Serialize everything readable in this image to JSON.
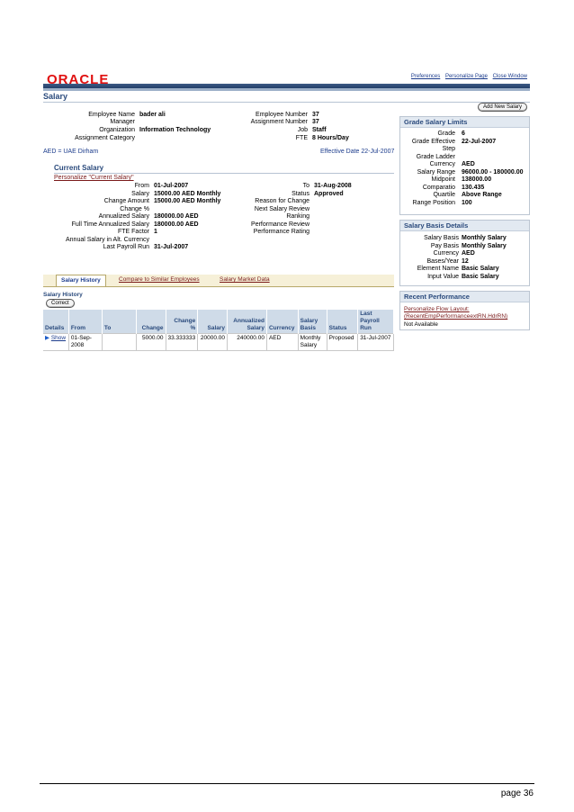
{
  "header": {
    "logo": "ORACLE",
    "links": [
      "Preferences",
      "Personalize Page",
      "Close Window"
    ],
    "page_title": "Salary",
    "add_button": "Add New Salary"
  },
  "employee": {
    "left": [
      {
        "label": "Employee Name",
        "value": "bader ali"
      },
      {
        "label": "Manager",
        "value": ""
      },
      {
        "label": "Organization",
        "value": "Information Technology"
      },
      {
        "label": "Assignment Category",
        "value": ""
      }
    ],
    "right": [
      {
        "label": "Employee Number",
        "value": "37"
      },
      {
        "label": "Assignment Number",
        "value": "37"
      },
      {
        "label": "Job",
        "value": "Staff"
      },
      {
        "label": "FTE",
        "value": "8 Hours/Day"
      }
    ]
  },
  "currency_note": "AED = UAE Dirham",
  "effective_date": "Effective Date 22-Jul-2007",
  "current_salary": {
    "title": "Current Salary",
    "personalize": "Personalize \"Current Salary\"",
    "left": [
      {
        "label": "From",
        "value": "01-Jul-2007"
      },
      {
        "label": "Salary",
        "value": "15000.00 AED Monthly"
      },
      {
        "label": "Change Amount",
        "value": "15000.00 AED Monthly"
      },
      {
        "label": "Change %",
        "value": ""
      },
      {
        "label": "Annualized Salary",
        "value": "180000.00 AED"
      },
      {
        "label": "Full Time Annualized Salary",
        "value": "180000.00 AED"
      },
      {
        "label": "FTE Factor",
        "value": "1"
      },
      {
        "label": "Annual Salary in Alt. Currency",
        "value": ""
      },
      {
        "label": "Last Payroll Run",
        "value": "31-Jul-2007"
      }
    ],
    "right": [
      {
        "label": "To",
        "value": "31-Aug-2008"
      },
      {
        "label": "Status",
        "value": "Approved"
      },
      {
        "label": "Reason for Change",
        "value": ""
      },
      {
        "label": "Next Salary Review",
        "value": ""
      },
      {
        "label": "Ranking",
        "value": ""
      },
      {
        "label": "Performance Review",
        "value": ""
      },
      {
        "label": "Performance Rating",
        "value": ""
      }
    ]
  },
  "tabs": [
    "Salary History",
    "Compare to Similar Employees",
    "Salary Market Data"
  ],
  "history": {
    "title": "Salary History",
    "correct_button": "Correct",
    "columns": [
      "Details",
      "From",
      "To",
      "Change",
      "Change %",
      "Salary",
      "Annualized Salary",
      "Currency",
      "Salary Basis",
      "Status",
      "Last Payroll Run"
    ],
    "rows": [
      {
        "details": "Show",
        "from": "01-Sep-2008",
        "to": "",
        "change": "5000.00",
        "change_pct": "33.333333",
        "salary": "20000.00",
        "annualized": "240000.00",
        "currency": "AED",
        "basis": "Monthly Salary",
        "status": "Proposed",
        "last_run": "31-Jul-2007"
      }
    ]
  },
  "grade_limits": {
    "title": "Grade Salary Limits",
    "rows": [
      {
        "label": "Grade",
        "value": "6"
      },
      {
        "label": "Grade Effective",
        "value": "22-Jul-2007"
      },
      {
        "label": "Step",
        "value": ""
      },
      {
        "label": "Grade Ladder",
        "value": ""
      },
      {
        "label": "Currency",
        "value": "AED"
      },
      {
        "label": "Salary Range",
        "value": "96000.00 - 180000.00"
      },
      {
        "label": "Midpoint",
        "value": "138000.00"
      },
      {
        "label": "Comparatio",
        "value": "130.435"
      },
      {
        "label": "Quartile",
        "value": "Above Range"
      },
      {
        "label": "Range Position",
        "value": "100"
      }
    ]
  },
  "basis_details": {
    "title": "Salary Basis Details",
    "rows": [
      {
        "label": "Salary Basis",
        "value": "Monthly Salary"
      },
      {
        "label": "Pay Basis",
        "value": "Monthly Salary"
      },
      {
        "label": "Currency",
        "value": "AED"
      },
      {
        "label": "Bases/Year",
        "value": "12"
      },
      {
        "label": "Element Name",
        "value": "Basic Salary"
      },
      {
        "label": "Input Value",
        "value": "Basic Salary"
      }
    ]
  },
  "recent_performance": {
    "title": "Recent Performance",
    "personalize_line1": "Personalize Flow Layout:",
    "personalize_line2": "(RecentEmpPerformanceextRN.HdrRN)",
    "status": "Not Available"
  },
  "footer": {
    "page": "page 36"
  }
}
